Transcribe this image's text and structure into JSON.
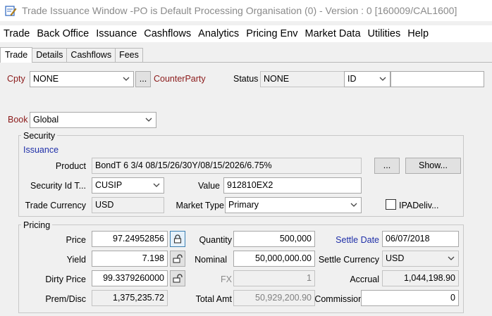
{
  "window": {
    "title": "Trade Issuance Window  -PO is Default Processing Organisation  (0) - Version : 0  [160009/CAL1600]"
  },
  "menu": [
    "Trade",
    "Back Office",
    "Issuance",
    "Cashflows",
    "Analytics",
    "Pricing Env",
    "Market Data",
    "Utilities",
    "Help"
  ],
  "tabs": [
    "Trade",
    "Details",
    "Cashflows",
    "Fees"
  ],
  "active_tab": "Trade",
  "top": {
    "cpty_label": "Cpty",
    "cpty_value": "NONE",
    "cpty_browse": "...",
    "counterparty_label": "CounterParty",
    "status_label": "Status",
    "status_value": "NONE",
    "id_type": "ID",
    "id_value": "",
    "book_label": "Book",
    "book_value": "Global"
  },
  "security": {
    "group_title": "Security",
    "issuance_label": "Issuance",
    "product_label": "Product",
    "product_value": "BondT 6 3/4 08/15/26/30Y/08/15/2026/6.75%",
    "product_browse": "...",
    "show_button": "Show...",
    "id_type_label": "Security Id T...",
    "id_type_value": "CUSIP",
    "value_label": "Value",
    "value_value": "912810EX2",
    "currency_label": "Trade Currency",
    "currency_value": "USD",
    "market_type_label": "Market Type",
    "market_type_value": "Primary",
    "ipa_label": "IPADeliv...",
    "ipa_checked": false
  },
  "pricing": {
    "group_title": "Pricing",
    "price_label": "Price",
    "price_value": "97.24952856",
    "yield_label": "Yield",
    "yield_value": "7.198",
    "dirty_label": "Dirty Price",
    "dirty_value": "99.3379260000",
    "prem_label": "Prem/Disc",
    "prem_value": "1,375,235.72",
    "quantity_label": "Quantity",
    "quantity_value": "500,000",
    "nominal_label": "Nominal",
    "nominal_value": "50,000,000.00",
    "fx_label": "FX",
    "fx_value": "1",
    "total_label": "Total Amt",
    "total_value": "50,929,200.90",
    "settle_date_label": "Settle Date",
    "settle_date_value": "06/07/2018",
    "settle_ccy_label": "Settle Currency",
    "settle_ccy_value": "USD",
    "accrual_label": "Accrual",
    "accrual_value": "1,044,198.90",
    "commission_label": "Commission (%)",
    "commission_value": "0"
  }
}
